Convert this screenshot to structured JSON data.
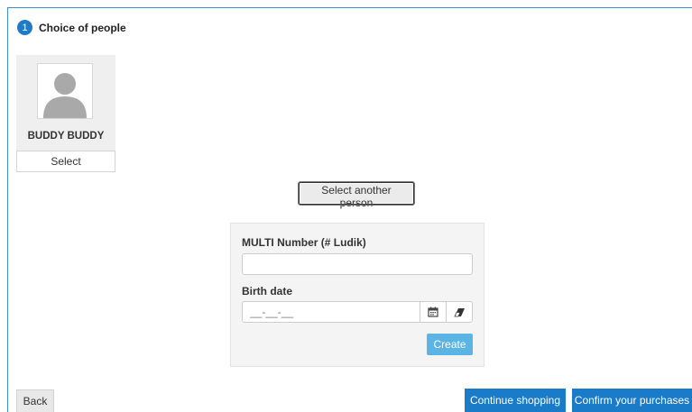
{
  "step": {
    "number": "1",
    "title": "Choice of people"
  },
  "person": {
    "name": "BUDDY BUDDY",
    "select_label": "Select",
    "avatar_icon": "user-silhouette-icon"
  },
  "select_another_label": "Select another person",
  "form": {
    "multi_label": "MULTI Number (# Ludik)",
    "multi_value": "",
    "birth_label": "Birth date",
    "birth_placeholder": "__-__-__",
    "calendar_icon": "calendar-icon",
    "clear_icon": "eraser-icon",
    "create_label": "Create"
  },
  "footer": {
    "back_label": "Back",
    "continue_label": "Continue shopping",
    "confirm_label": "Confirm your purchases"
  },
  "colors": {
    "primary": "#1a7bc9",
    "create": "#5ab4e4",
    "frame_border": "#3b8fd0"
  }
}
